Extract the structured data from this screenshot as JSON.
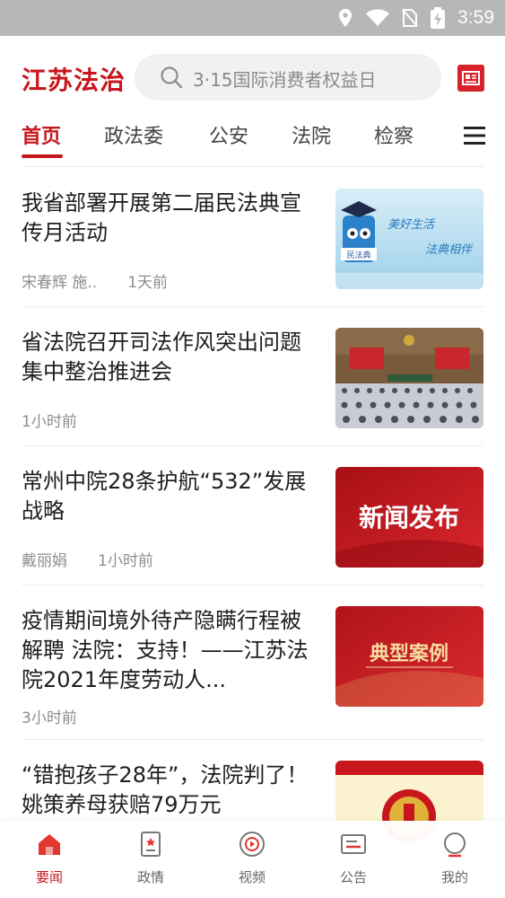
{
  "status_bar": {
    "time": "3:59"
  },
  "header": {
    "logo": "江苏法治",
    "search_placeholder": "3·15国际消费者权益日"
  },
  "tabs": [
    "首页",
    "政法委",
    "公安",
    "法院",
    "检察"
  ],
  "articles": [
    {
      "title": "我省部署开展第二届民法典宣传月活动",
      "author": "宋春辉 施..",
      "time": "1天前",
      "thumb": {
        "badge": "民法典",
        "line1": "美好生活",
        "line2": "法典相伴"
      }
    },
    {
      "title": "省法院召开司法作风突出问题集中整治推进会",
      "author": "",
      "time": "1小时前",
      "thumb": {}
    },
    {
      "title": "常州中院28条护航“532”发展战略",
      "author": "戴丽娟",
      "time": "1小时前",
      "thumb": {
        "caption": "新闻发布"
      }
    },
    {
      "title": "疫情期间境外待产隐瞒行程被解聘 法院：支持！——江苏法院2021年度劳动人...",
      "author": "",
      "time": "3小时前",
      "thumb": {
        "caption": "典型案例"
      }
    },
    {
      "title": "“错抱孩子28年”，法院判了！ 姚策养母获赔79万元",
      "author": "",
      "time": "",
      "thumb": {}
    }
  ],
  "bottom_nav": [
    {
      "label": "要闻",
      "icon": "home-icon"
    },
    {
      "label": "政情",
      "icon": "document-icon"
    },
    {
      "label": "视频",
      "icon": "video-icon"
    },
    {
      "label": "公告",
      "icon": "notice-icon"
    },
    {
      "label": "我的",
      "icon": "profile-icon"
    }
  ],
  "colors": {
    "brand_red": "#c8161d",
    "status_bar": "#b7b7b7"
  }
}
